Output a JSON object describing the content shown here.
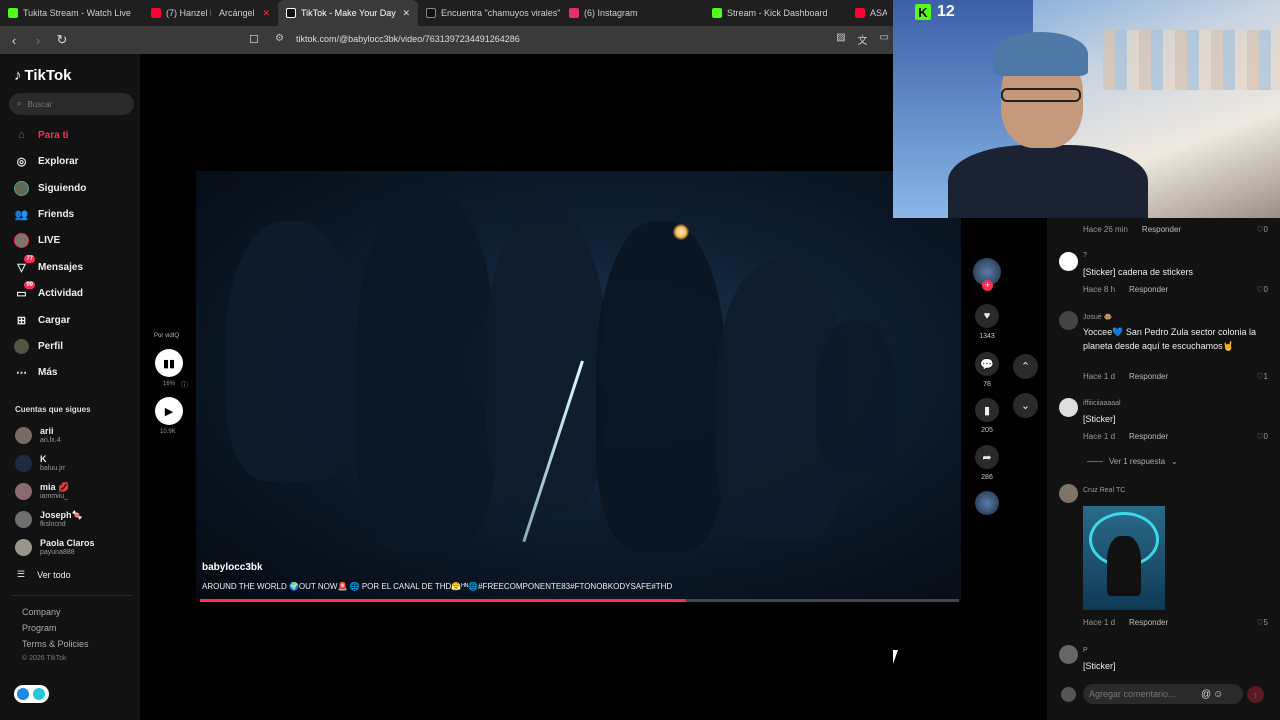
{
  "browser": {
    "tabs": [
      {
        "title": "Tukita Stream - Watch Live",
        "color": "#53fc18"
      },
      {
        "title": "(7) Hanzel La H",
        "color": "#ff0033"
      },
      {
        "title": "Arcángel",
        "color": "#ff0033"
      },
      {
        "title": "TikTok - Make Your Day",
        "color": "#ffffff"
      },
      {
        "title": "Encuentra \"chamuyos virales\"",
        "color": "#ffffff"
      },
      {
        "title": "(6) Instagram",
        "color": "#e1306c"
      },
      {
        "title": "Stream - Kick Dashboard",
        "color": "#53fc18"
      },
      {
        "title": "ASA",
        "color": "#ff0033"
      }
    ],
    "url": "tiktok.com/@babylocc3bk/video/7631397234491264286"
  },
  "sidebar": {
    "brand": "TikTok",
    "search_placeholder": "Buscar",
    "menu": [
      {
        "label": "Para ti",
        "icon": "home-icon",
        "badge": ""
      },
      {
        "label": "Explorar",
        "icon": "compass-icon",
        "badge": ""
      },
      {
        "label": "Siguiendo",
        "icon": "following-avatar-icon",
        "badge": ""
      },
      {
        "label": "Friends",
        "icon": "friends-icon",
        "badge": ""
      },
      {
        "label": "LIVE",
        "icon": "live-icon",
        "badge": ""
      },
      {
        "label": "Mensajes",
        "icon": "messages-icon",
        "badge": "77"
      },
      {
        "label": "Actividad",
        "icon": "activity-icon",
        "badge": "99"
      },
      {
        "label": "Cargar",
        "icon": "upload-icon",
        "badge": ""
      },
      {
        "label": "Perfil",
        "icon": "profile-icon",
        "badge": ""
      },
      {
        "label": "Más",
        "icon": "more-icon",
        "badge": ""
      }
    ],
    "following_title": "Cuentas que sigues",
    "following": [
      {
        "name": "arii",
        "handle": "ari.lx.4"
      },
      {
        "name": "K",
        "handle": "baluu.jrr"
      },
      {
        "name": "mia 💋",
        "handle": "iammiiu_"
      },
      {
        "name": "Joseph🍬",
        "handle": "fkslncnd"
      },
      {
        "name": "Paola Claros",
        "handle": "payuna888"
      }
    ],
    "see_all": "Ver todo",
    "footer": [
      "Company",
      "Program",
      "Terms & Policies"
    ],
    "copyright": "© 2026 TikTok"
  },
  "video": {
    "username": "babylocc3bk",
    "caption": "AROUND THE WORLD 🌍OUT NOW🚨 🌐 POR EL CANAL DE THD😤ᴴᴺ🌐#FREECOMPONENTE83#FTONOBKODYSAFE#THD",
    "progress": 0.64
  },
  "vidiq": {
    "label": "Por vidIQ",
    "percent": "16%",
    "views": "10.9K"
  },
  "actions": {
    "likes": "1343",
    "comments": "78",
    "saves": "205",
    "shares": "286"
  },
  "comments": {
    "items": [
      {
        "meta_time": "Hace 26 min",
        "reply": "Responder",
        "likes": "0"
      },
      {
        "user": "?",
        "text": "[Sticker] cadena de stickers",
        "time": "Hace 8 h",
        "reply": "Responder",
        "likes": "0"
      },
      {
        "user": "Josué 🐵",
        "text": "Yoccee💙 San Pedro Zula sector colonia la planeta desde aquí te escuchamos🤘",
        "time": "Hace 1 d",
        "reply": "Responder",
        "likes": "1"
      },
      {
        "user": "iffiiiciiaaaaal",
        "text": "[Sticker]",
        "time": "Hace 1 d",
        "reply": "Responder",
        "likes": "0"
      },
      {
        "user": "Cruz Real TC",
        "time": "Hace 1 d",
        "reply": "Responder",
        "likes": "5"
      },
      {
        "user": "P",
        "text": "[Sticker]"
      }
    ],
    "view_replies": "Ver 1 respuesta",
    "input_placeholder": "Agregar comentario..."
  },
  "stream": {
    "viewers": "12"
  },
  "colors": {
    "accent": "#fe2c55",
    "kick": "#53fc18"
  }
}
